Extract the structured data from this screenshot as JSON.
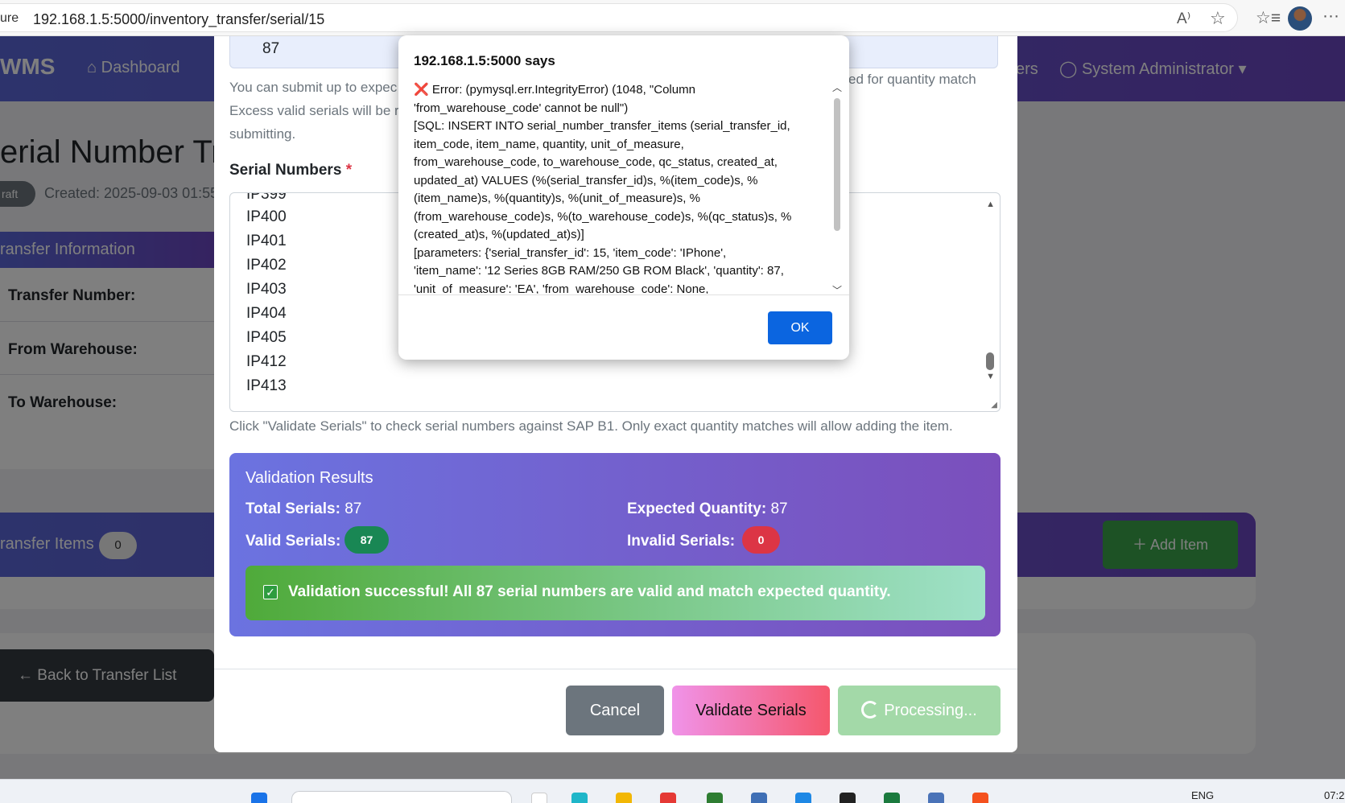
{
  "browser": {
    "secure_label": "ure",
    "url": "192.168.1.5:5000/inventory_transfer/serial/15",
    "read_aloud_icon": "A⁾",
    "favorite_icon": "☆",
    "favorites_bar_icon": "☆≡",
    "more_icon": "···"
  },
  "app": {
    "brand": "WMS",
    "nav": {
      "dashboard": "Dashboard",
      "users_partial": "ers",
      "admin": "System Administrator"
    },
    "page_title": "erial Number Tr",
    "status_badge": "raft",
    "created": "Created: 2025-09-03 01:55",
    "info": {
      "header": "ransfer Information",
      "transfer_number_label": "Transfer Number:",
      "from_label": "From Warehouse:",
      "to_label": "To Warehouse:"
    },
    "items": {
      "title": "ransfer Items",
      "count": "0",
      "add_button": "Add Item"
    },
    "back_button": "Back to Transfer List"
  },
  "modal": {
    "quantity_value": "87",
    "help_left_1": "You can submit up to expec",
    "help_right_1": "ed for quantity match",
    "help_left_2": "Excess valid serials will be re",
    "help_left_3": "submitting.",
    "serial_label": "Serial Numbers",
    "required_mark": "*",
    "serials": [
      "IP399",
      "IP400",
      "IP401",
      "IP402",
      "IP403",
      "IP404",
      "IP405",
      "IP412",
      "IP413"
    ],
    "help_text": "Click \"Validate Serials\" to check serial numbers against SAP B1. Only exact quantity matches will allow adding the item.",
    "validation": {
      "title": "Validation Results",
      "total_label": "Total Serials:",
      "total_value": "87",
      "expected_label": "Expected Quantity:",
      "expected_value": "87",
      "valid_label": "Valid Serials:",
      "valid_value": "87",
      "invalid_label": "Invalid Serials:",
      "invalid_value": "0",
      "success_message": "Validation successful! All 87 serial numbers are valid and match expected quantity."
    },
    "buttons": {
      "cancel": "Cancel",
      "validate": "Validate Serials",
      "processing": "Processing..."
    }
  },
  "alert": {
    "title": "192.168.1.5:5000 says",
    "error_icon": "❌",
    "message": " Error: (pymysql.err.IntegrityError) (1048, \"Column\n'from_warehouse_code' cannot be null\")\n[SQL: INSERT INTO serial_number_transfer_items (serial_transfer_id,\nitem_code, item_name, quantity, unit_of_measure,\nfrom_warehouse_code, to_warehouse_code, qc_status, created_at,\nupdated_at) VALUES (%(serial_transfer_id)s, %(item_code)s, %\n(item_name)s, %(quantity)s, %(unit_of_measure)s, %\n(from_warehouse_code)s, %(to_warehouse_code)s, %(qc_status)s, %\n(created_at)s, %(updated_at)s)]\n[parameters: {'serial_transfer_id': 15, 'item_code': 'IPhone',\n'item_name': '12 Series 8GB RAM/250 GB ROM Black', 'quantity': 87,\n'unit_of_measure': 'EA', 'from_warehouse_code': None,",
    "ok": "OK"
  },
  "taskbar": {
    "lang": "ENG",
    "time": "07:2"
  },
  "colors": {
    "primary": "#5a67d8",
    "secondary": "#6b46c1",
    "ok_button": "#0b65e0",
    "success_pill": "#198754",
    "danger_pill": "#dc3545"
  }
}
